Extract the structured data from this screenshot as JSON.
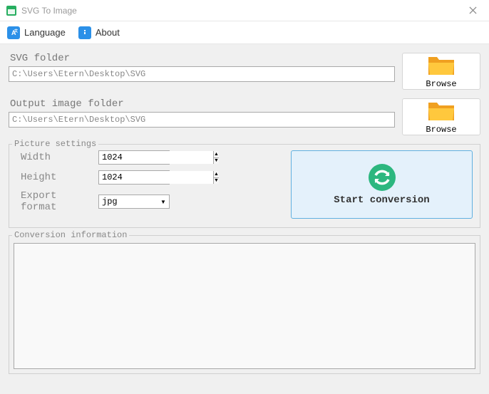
{
  "window": {
    "title": "SVG To Image"
  },
  "menu": {
    "language": "Language",
    "about": "About"
  },
  "svg_folder": {
    "label": "SVG folder",
    "value": "C:\\Users\\Etern\\Desktop\\SVG",
    "browse": "Browse"
  },
  "output_folder": {
    "label": "Output image folder",
    "value": "C:\\Users\\Etern\\Desktop\\SVG",
    "browse": "Browse"
  },
  "settings": {
    "legend": "Picture settings",
    "width_label": "Width",
    "width_value": "1024",
    "height_label": "Height",
    "height_value": "1024",
    "format_label": "Export format",
    "format_value": "jpg"
  },
  "start_button": "Start conversion",
  "info": {
    "legend": "Conversion information"
  }
}
